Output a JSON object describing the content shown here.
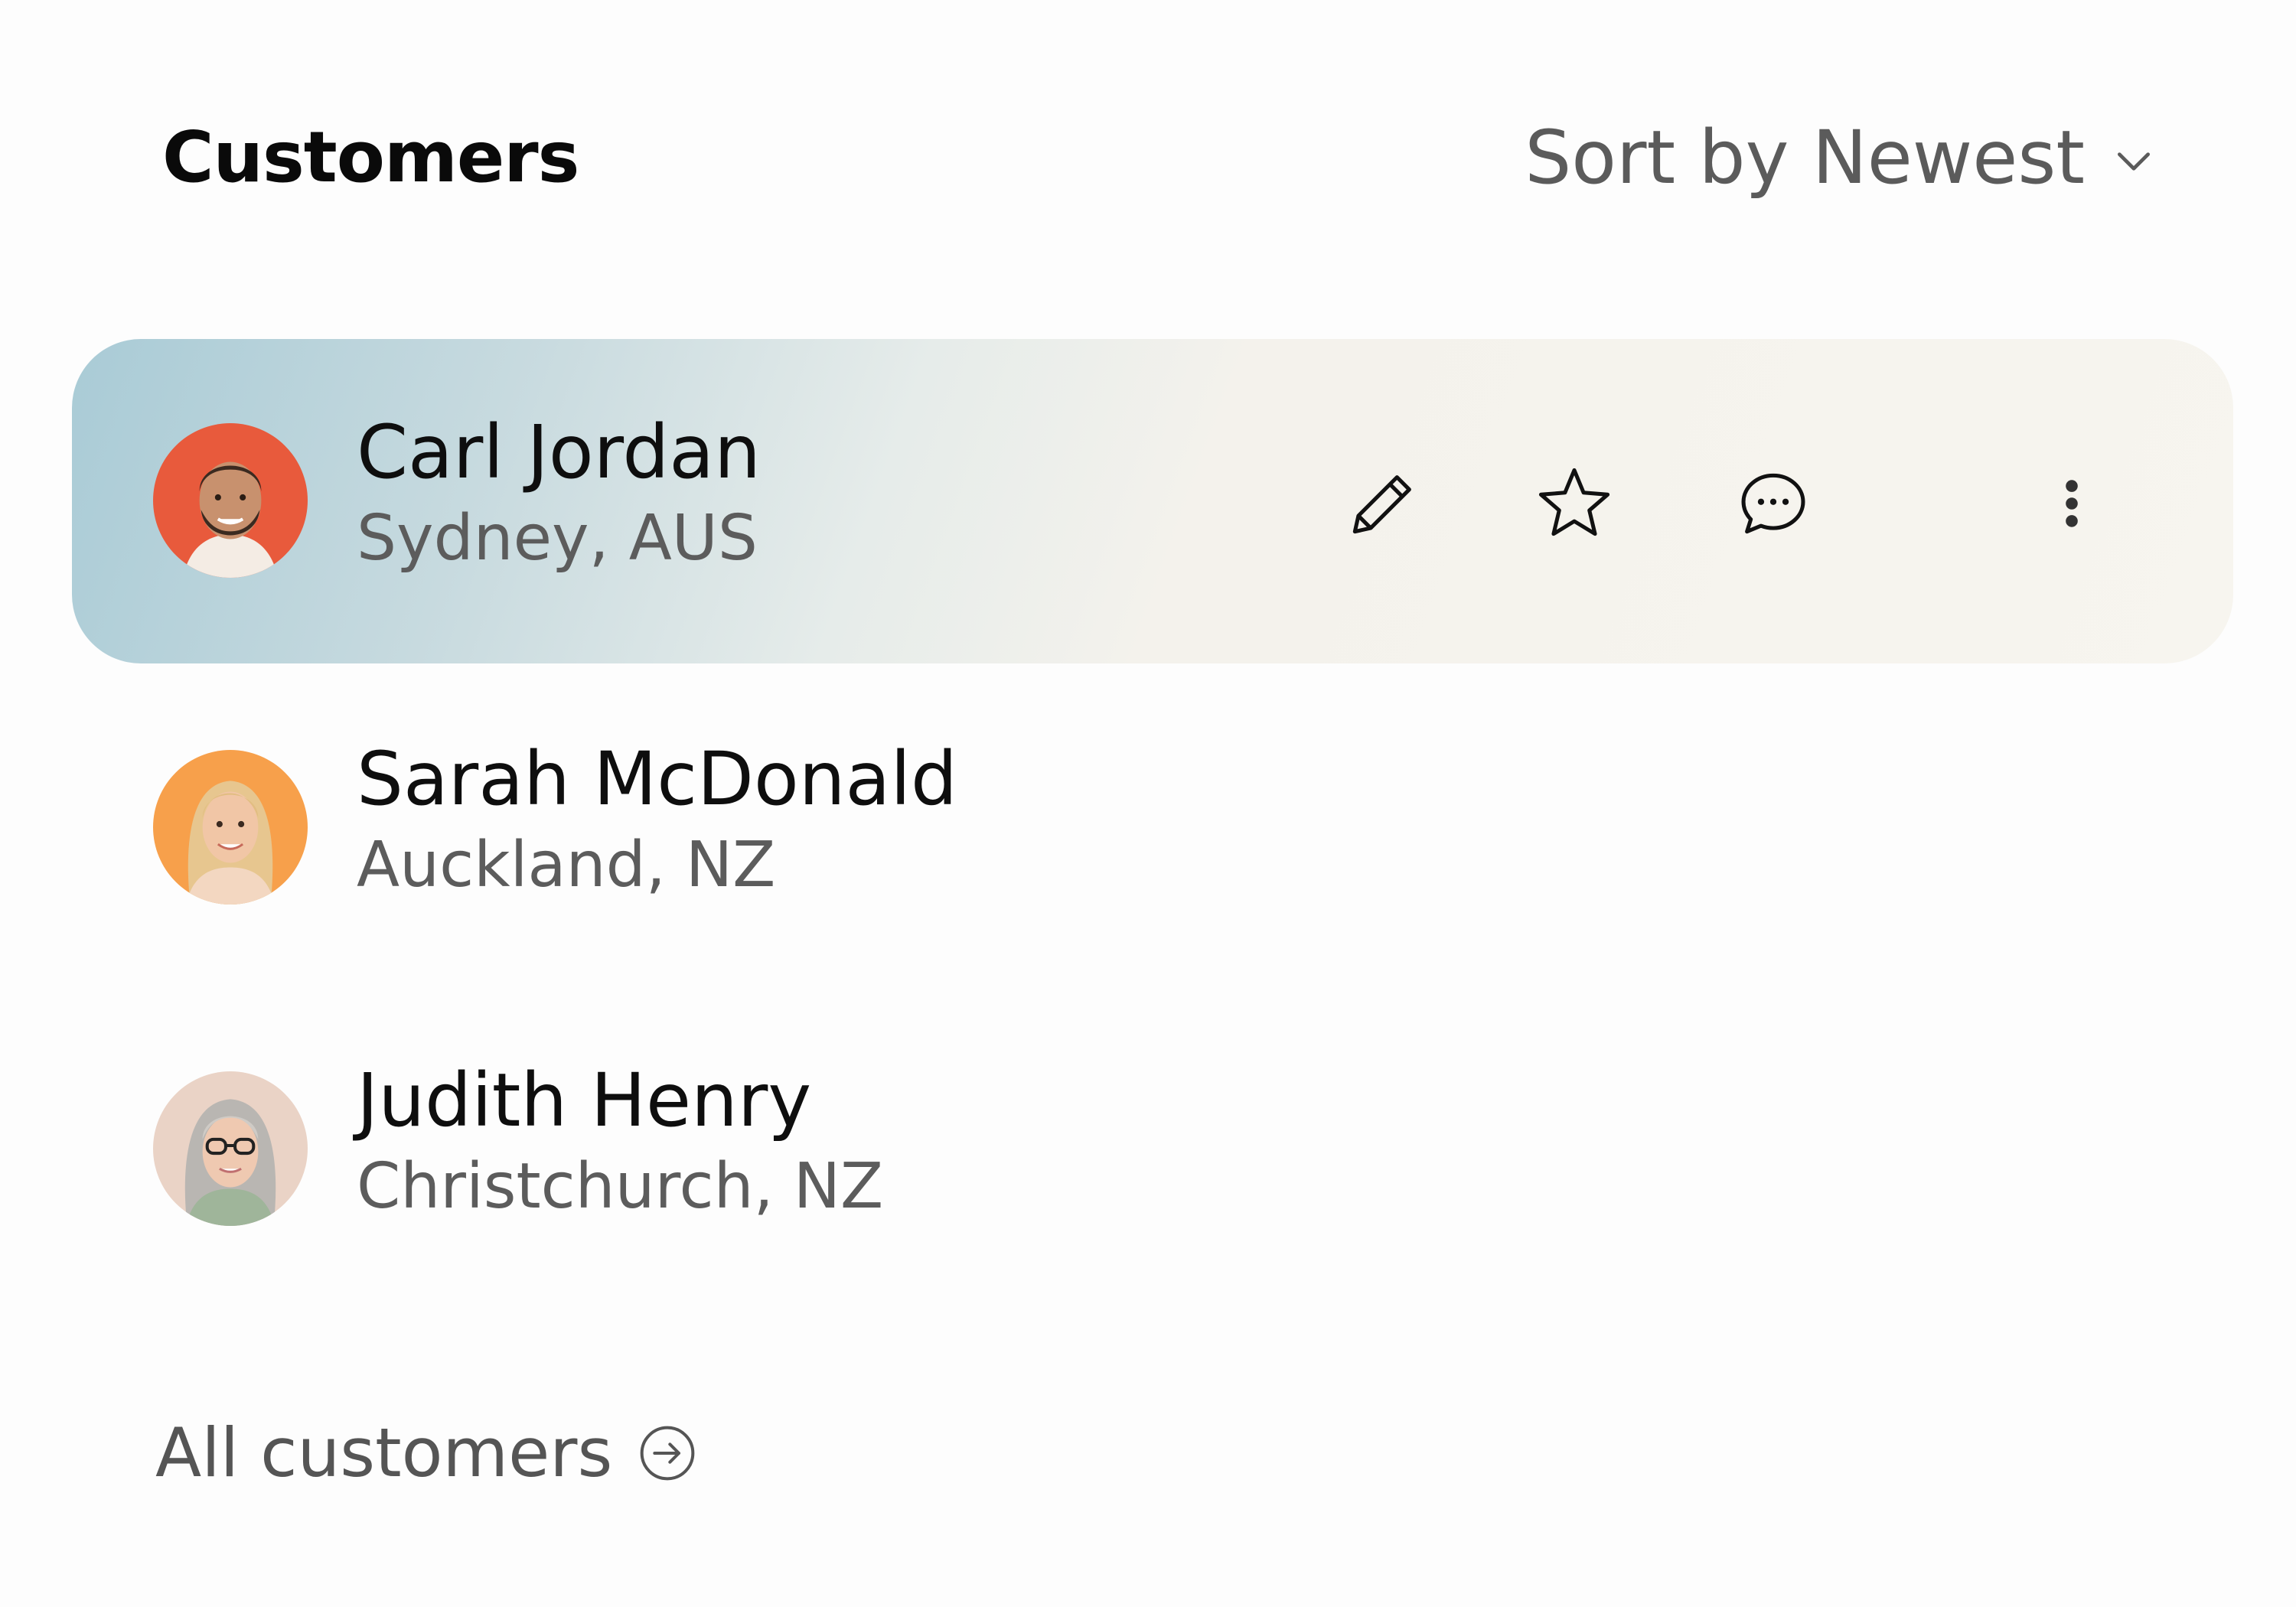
{
  "header": {
    "title": "Customers",
    "sort_label": "Sort by Newest"
  },
  "customers": [
    {
      "name": "Carl Jordan",
      "location": "Sydney, AUS",
      "avatar_bg": "#e85a3c",
      "active": true
    },
    {
      "name": "Sarah McDonald",
      "location": "Auckland, NZ",
      "avatar_bg": "#f7a04b",
      "active": false
    },
    {
      "name": "Judith Henry",
      "location": "Christchurch, NZ",
      "avatar_bg": "#ead3c6",
      "active": false
    }
  ],
  "row_actions": {
    "icons": [
      "pencil-icon",
      "star-icon",
      "chat-bubble-icon",
      "more-vertical-icon"
    ]
  },
  "footer": {
    "all_customers_label": "All customers"
  }
}
